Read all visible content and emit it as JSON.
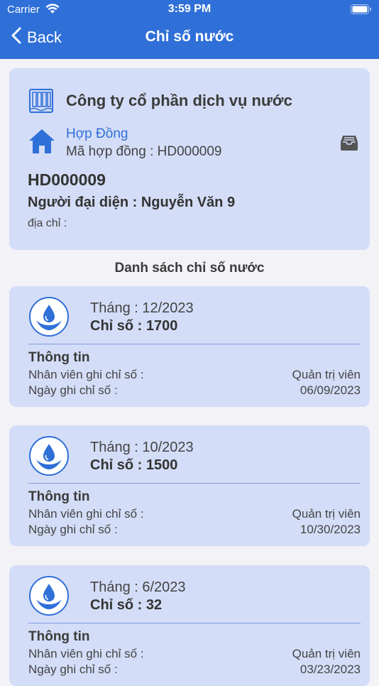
{
  "status_bar": {
    "carrier": "Carrier",
    "time": "3:59 PM"
  },
  "nav": {
    "back_label": "Back",
    "title": "Chỉ số nước"
  },
  "contract": {
    "company": "Công ty cổ phần dịch vụ nước",
    "link_label": "Hợp Đồng",
    "code_label": "Mã hợp đồng : HD000009",
    "id": "HD000009",
    "representative": "Người đại diện : Nguyễn Văn 9",
    "address": "địa chỉ :"
  },
  "list_title": "Danh sách chỉ số nước",
  "readings": [
    {
      "month": "Tháng : 12/2023",
      "value": "Chỉ số : 1700",
      "info_label": "Thông tin",
      "staff_label": "Nhân viên ghi chỉ số :",
      "staff": "Quản trị viên",
      "date_label": "Ngày ghi chỉ số :",
      "date": "06/09/2023"
    },
    {
      "month": "Tháng : 10/2023",
      "value": "Chỉ số : 1500",
      "info_label": "Thông tin",
      "staff_label": "Nhân viên ghi chỉ số :",
      "staff": "Quản trị viên",
      "date_label": "Ngày ghi chỉ số :",
      "date": "10/30/2023"
    },
    {
      "month": "Tháng : 6/2023",
      "value": "Chỉ số : 32",
      "info_label": "Thông tin",
      "staff_label": "Nhân viên ghi chỉ số :",
      "staff": "Quản trị viên",
      "date_label": "Ngày ghi chỉ số :",
      "date": "03/23/2023"
    }
  ],
  "icons": {
    "back": "chevron-left-icon",
    "company": "water-filter-icon",
    "home": "home-icon",
    "tray": "tray-icon",
    "reading": "water-drop-hands-icon"
  },
  "colors": {
    "accent": "#2f6fd8",
    "card": "#d4ddf7"
  }
}
